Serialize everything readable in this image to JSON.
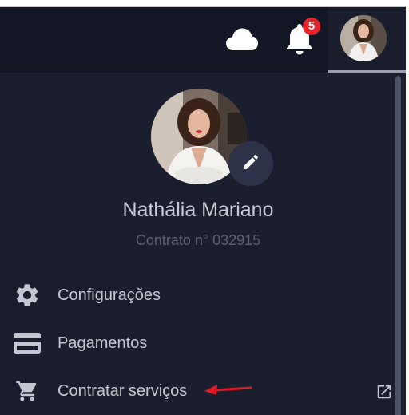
{
  "colors": {
    "header_bg": "#131624",
    "panel_bg": "#1b1e2e",
    "text": "#c4c7d1",
    "muted": "#5b6075",
    "badge": "#e5242b",
    "annotation_arrow": "#e01a22"
  },
  "header": {
    "cloud_icon": "cloud-icon",
    "bell_icon": "bell-icon",
    "notification_count": "5"
  },
  "profile": {
    "name": "Nathália Mariano",
    "contract": "Contrato n° 032915",
    "edit_icon": "pencil-icon"
  },
  "menu": [
    {
      "label": "Configurações",
      "icon": "gear-icon"
    },
    {
      "label": "Pagamentos",
      "icon": "credit-card-icon"
    },
    {
      "label": "Contratar serviços",
      "icon": "cart-icon",
      "external_icon": "external-link-icon"
    }
  ]
}
